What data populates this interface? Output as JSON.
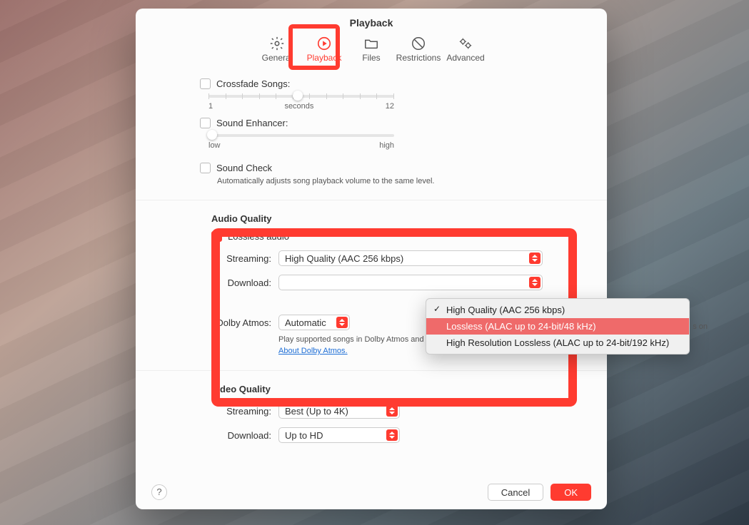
{
  "window": {
    "title": "Playback"
  },
  "tabs": {
    "general": "General",
    "playback": "Playback",
    "files": "Files",
    "restrictions": "Restrictions",
    "advanced": "Advanced"
  },
  "crossfade": {
    "label": "Crossfade Songs:",
    "min": "1",
    "unit": "seconds",
    "max": "12"
  },
  "enhancer": {
    "label": "Sound Enhancer:",
    "low": "low",
    "high": "high"
  },
  "soundcheck": {
    "label": "Sound Check",
    "desc": "Automatically adjusts song playback volume to the same level."
  },
  "audio": {
    "heading": "Audio Quality",
    "lossless_label": "Lossless audio",
    "streaming_label": "Streaming:",
    "streaming_value": "High Quality (AAC 256 kbps)",
    "download_label": "Download:",
    "truncated": "s on",
    "dolby_label": "Dolby Atmos:",
    "dolby_value": "Automatic",
    "dolby_desc": "Play supported songs in Dolby Atmos and other Dolby Audio formats.",
    "dolby_link": "About Dolby Atmos."
  },
  "dropdown": {
    "opt1": "High Quality (AAC 256 kbps)",
    "opt2": "Lossless (ALAC up to 24-bit/48 kHz)",
    "opt3": "High Resolution Lossless (ALAC up to 24-bit/192 kHz)"
  },
  "video": {
    "heading": "Video Quality",
    "streaming_label": "Streaming:",
    "streaming_value": "Best (Up to 4K)",
    "download_label": "Download:",
    "download_value": "Up to HD"
  },
  "footer": {
    "help": "?",
    "cancel": "Cancel",
    "ok": "OK"
  }
}
